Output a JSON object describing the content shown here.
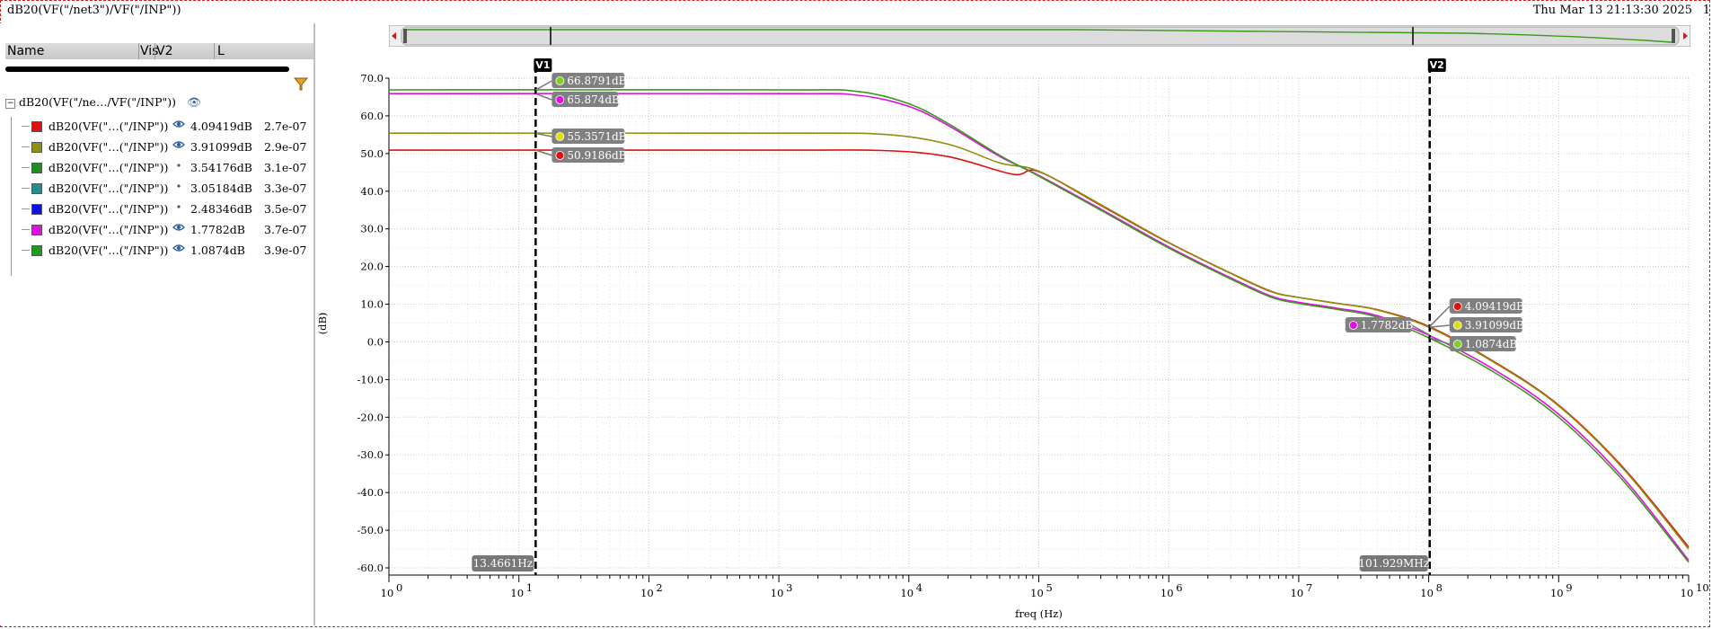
{
  "window": {
    "title": "dB20(VF(\"/net3\")/VF(\"/INP\"))",
    "datetime": "Thu Mar 13 21:13:30 2025",
    "datetime_extra": "1"
  },
  "tree": {
    "columns": [
      "Name",
      "Vis",
      "V2",
      "L"
    ],
    "root_label": "dB20(VF(\"/ne…/VF(\"/INP\"))",
    "rows": [
      {
        "name": "dB20(VF(\"…(\"/INP\"))",
        "color": "#e01010",
        "visible": "eye",
        "v2": "4.09419dB",
        "l": "2.7e-07"
      },
      {
        "name": "dB20(VF(\"…(\"/INP\"))",
        "color": "#8f8f10",
        "visible": "eye",
        "v2": "3.91099dB",
        "l": "2.9e-07"
      },
      {
        "name": "dB20(VF(\"…(\"/INP\"))",
        "color": "#1f8f1f",
        "visible": "dot",
        "v2": "3.54176dB",
        "l": "3.1e-07"
      },
      {
        "name": "dB20(VF(\"…(\"/INP\"))",
        "color": "#1f8f8f",
        "visible": "dot",
        "v2": "3.05184dB",
        "l": "3.3e-07"
      },
      {
        "name": "dB20(VF(\"…(\"/INP\"))",
        "color": "#1010e0",
        "visible": "dot",
        "v2": "2.48346dB",
        "l": "3.5e-07"
      },
      {
        "name": "dB20(VF(\"…(\"/INP\"))",
        "color": "#e010e0",
        "visible": "eye",
        "v2": "1.7782dB",
        "l": "3.7e-07"
      },
      {
        "name": "dB20(VF(\"…(\"/INP\"))",
        "color": "#1f9a1f",
        "visible": "eye",
        "v2": "1.0874dB",
        "l": "3.9e-07"
      }
    ]
  },
  "chart_data": {
    "type": "line",
    "xlabel": "freq (Hz)",
    "ylabel": "(dB)",
    "xscale": "log",
    "xlim_exp": [
      0,
      10
    ],
    "ylim": [
      -60,
      70
    ],
    "yticks": [
      "70.0",
      "60.0",
      "50.0",
      "40.0",
      "30.0",
      "20.0",
      "10.0",
      "0.0",
      "-10.0",
      "-20.0",
      "-30.0",
      "-40.0",
      "-50.0",
      "-60.0"
    ],
    "grid": true,
    "series": [
      {
        "color": "#e01010",
        "points": [
          [
            0,
            50.9
          ],
          [
            3,
            50.9
          ],
          [
            3.8,
            50.8
          ],
          [
            4.3,
            49.2
          ],
          [
            4.8,
            44.5
          ],
          [
            5,
            45.2
          ],
          [
            5.5,
            35.8
          ],
          [
            6,
            26.3
          ],
          [
            6.5,
            17.8
          ],
          [
            6.8,
            13.2
          ],
          [
            7,
            11.8
          ],
          [
            7.3,
            10.2
          ],
          [
            7.6,
            8.6
          ],
          [
            8,
            4.1
          ],
          [
            8.5,
            -5.2
          ],
          [
            9,
            -16.8
          ],
          [
            9.5,
            -33.5
          ],
          [
            10,
            -54.5
          ]
        ]
      },
      {
        "color": "#8f8f10",
        "points": [
          [
            0,
            55.4
          ],
          [
            3,
            55.4
          ],
          [
            3.8,
            55.1
          ],
          [
            4.3,
            52.5
          ],
          [
            4.7,
            47.5
          ],
          [
            5,
            45.3
          ],
          [
            5.5,
            36.0
          ],
          [
            6,
            26.4
          ],
          [
            6.5,
            17.9
          ],
          [
            6.8,
            13.3
          ],
          [
            7,
            11.8
          ],
          [
            7.3,
            10.2
          ],
          [
            7.6,
            8.5
          ],
          [
            8,
            3.9
          ],
          [
            8.5,
            -5.4
          ],
          [
            9,
            -17.0
          ],
          [
            9.5,
            -33.8
          ],
          [
            10,
            -55.0
          ]
        ]
      },
      {
        "color": "#e010e0",
        "points": [
          [
            0,
            65.9
          ],
          [
            3,
            65.9
          ],
          [
            3.6,
            65.5
          ],
          [
            4,
            62.5
          ],
          [
            4.3,
            57.5
          ],
          [
            4.7,
            49.2
          ],
          [
            5,
            44.2
          ],
          [
            5.5,
            34.8
          ],
          [
            6,
            25.2
          ],
          [
            6.5,
            16.6
          ],
          [
            6.8,
            12.0
          ],
          [
            7,
            10.5
          ],
          [
            7.3,
            8.9
          ],
          [
            7.6,
            7.0
          ],
          [
            8,
            1.8
          ],
          [
            8.5,
            -7.3
          ],
          [
            9,
            -19.2
          ],
          [
            9.5,
            -36.2
          ],
          [
            10,
            -58.0
          ]
        ]
      },
      {
        "color": "#3a9a1a",
        "points": [
          [
            0,
            66.9
          ],
          [
            3,
            66.9
          ],
          [
            3.6,
            66.5
          ],
          [
            4,
            63.2
          ],
          [
            4.3,
            58.0
          ],
          [
            4.7,
            49.5
          ],
          [
            5,
            44.0
          ],
          [
            5.5,
            34.5
          ],
          [
            6,
            24.9
          ],
          [
            6.5,
            16.3
          ],
          [
            6.8,
            11.7
          ],
          [
            7,
            10.2
          ],
          [
            7.3,
            8.6
          ],
          [
            7.6,
            6.6
          ],
          [
            8,
            1.1
          ],
          [
            8.5,
            -8.0
          ],
          [
            9,
            -20.0
          ],
          [
            9.5,
            -37.0
          ],
          [
            10,
            -58.5
          ]
        ]
      }
    ],
    "cursors": [
      {
        "label": "V1",
        "x_exp": 1.129,
        "readout": "13.4661Hz"
      },
      {
        "label": "V2",
        "x_exp": 8.008,
        "readout": "101.929MHz"
      }
    ],
    "markers": [
      {
        "text": "66.8791dB",
        "dot": "#7fd020",
        "cursor": "V1"
      },
      {
        "text": "65.874dB",
        "dot": "#e010e0",
        "cursor": "V1"
      },
      {
        "text": "55.3571dB",
        "dot": "#e0e010",
        "cursor": "V1"
      },
      {
        "text": "50.9186dB",
        "dot": "#e01010",
        "cursor": "V1"
      },
      {
        "text": "4.09419dB",
        "dot": "#e01010",
        "cursor": "V2"
      },
      {
        "text": "3.91099dB",
        "dot": "#e0e010",
        "cursor": "V2"
      },
      {
        "text": "1.7782dB",
        "dot": "#e010e0",
        "cursor": "V2"
      },
      {
        "text": "1.0874dB",
        "dot": "#7fd020",
        "cursor": "V2"
      }
    ]
  }
}
